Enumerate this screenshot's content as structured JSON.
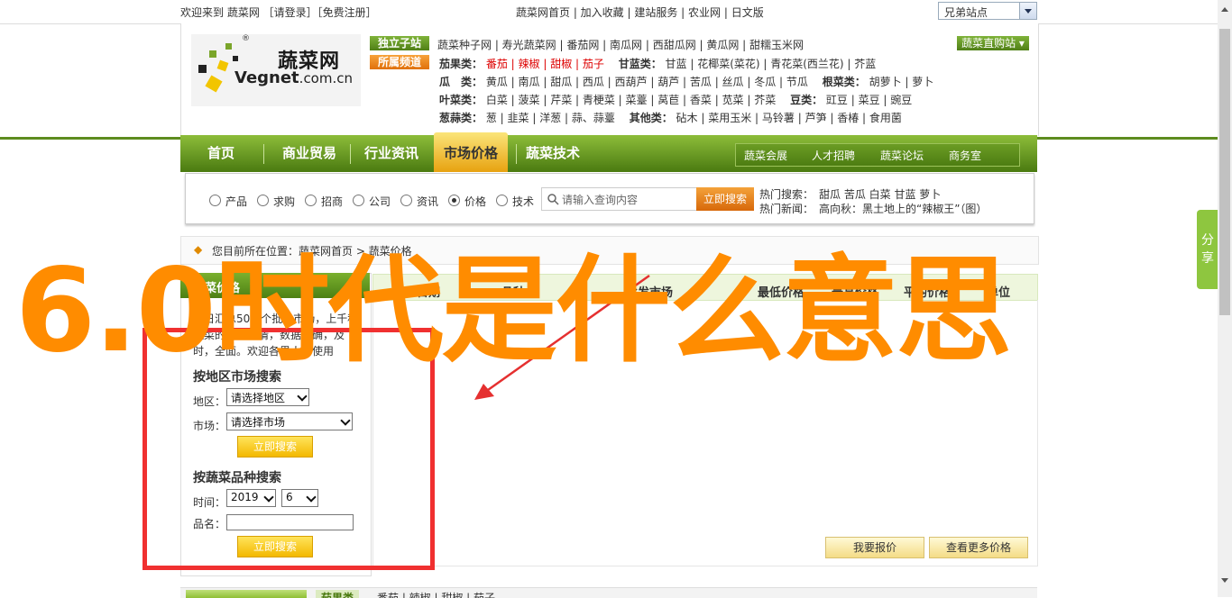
{
  "topbar": {
    "welcome": "欢迎来到 蔬菜网 ［请登录］［免费注册］",
    "links": "蔬菜网首页 | 加入收藏 | 建站服务 | 农业网 | 日文版",
    "site_select": "兄弟站点"
  },
  "logo": {
    "cn": "蔬菜网",
    "en": "Vegnet",
    "en_suffix": ".com.cn",
    "reg": "®"
  },
  "tags": {
    "independent": "独立子站",
    "channel": "所属频道",
    "direct_buy": "蔬菜直购站"
  },
  "subsites": "蔬菜种子网 | 寿光蔬菜网 | 番茄网 | 南瓜网 | 西甜瓜网 | 黄瓜网 | 甜糯玉米网",
  "categories": [
    {
      "label": "茄果类：",
      "items": "番茄 | 辣椒 | 甜椒 | 茄子",
      "label2": "甘蓝类：",
      "items2": "甘蓝 | 花椰菜(菜花) | 青花菜(西兰花) | 芥蓝"
    },
    {
      "label": "瓜　类：",
      "items": "黄瓜 | 南瓜 | 甜瓜 | 西瓜 | 西葫芦 | 葫芦 | 苦瓜 | 丝瓜 | 冬瓜 | 节瓜",
      "label2": "根菜类：",
      "items2": "胡萝卜 | 萝卜"
    },
    {
      "label": "叶菜类：",
      "items": "白菜 | 菠菜 | 芹菜 | 青梗菜 | 菜薹 | 莴苣 | 香菜 | 苋菜 | 芥菜",
      "label2": "豆类：",
      "items2": "豇豆 | 菜豆 | 豌豆"
    },
    {
      "label": "葱蒜类：",
      "items": "葱 | 韭菜 | 洋葱 | 蒜、蒜薹",
      "label2": "其他类：",
      "items2": "砧木 | 菜用玉米 | 马铃薯 | 芦笋 | 香椿 | 食用菌"
    }
  ],
  "nav": {
    "items": [
      "首页",
      "商业贸易",
      "行业资讯",
      "市场价格",
      "蔬菜技术"
    ],
    "sub": [
      "蔬菜会展",
      "人才招聘",
      "蔬菜论坛",
      "商务室"
    ]
  },
  "search": {
    "radios": [
      "产品",
      "求购",
      "招商",
      "公司",
      "资讯",
      "价格",
      "技术"
    ],
    "selected": "价格",
    "placeholder": "请输入查询内容",
    "button": "立即搜索",
    "hot_search": "热门搜索：　甜瓜 苦瓜 白菜 甘蓝 萝卜",
    "hot_news": "热门新闻：　高向秋：黑土地上的“辣椒王”（图）"
  },
  "breadcrumb": "您目前所在位置：蔬菜网首页 > 蔬菜价格",
  "left_panel": {
    "title": "蔬菜价格",
    "intro1": "每日汇总50多个批发市场，上千种",
    "intro2": "蔬菜的价格行情，数据准确，及",
    "intro3": "时，全面。欢迎各界人士使用",
    "region_title": "按地区市场搜索",
    "region_label": "地区：",
    "region_value": "请选择地区",
    "market_label": "市场：",
    "market_value": "请选择市场",
    "btn1": "立即搜索",
    "variety_title": "按蔬菜品种搜索",
    "time_label": "时间：",
    "year": "2019",
    "month": "6",
    "name_label": "品名：",
    "btn2": "立即搜索"
  },
  "table": {
    "headers": [
      "日期",
      "品种",
      "批发市场",
      "最低价格",
      "最高价格",
      "平均价格",
      "单位"
    ],
    "btn_quote": "我要报价",
    "btn_more": "查看更多价格"
  },
  "bottom": {
    "label": "茄果类",
    "items": "番茄 | 辣椒 | 甜椒 | 茄子"
  },
  "share": "分享",
  "overlay": {
    "text": "6.0时代是什么意思",
    "color": "#ff8c00",
    "box_color": "#f03030"
  },
  "colors": {
    "brand_green": "#5d8c1e",
    "nav_active": "#f0b020",
    "red_link": "#dd0000"
  }
}
